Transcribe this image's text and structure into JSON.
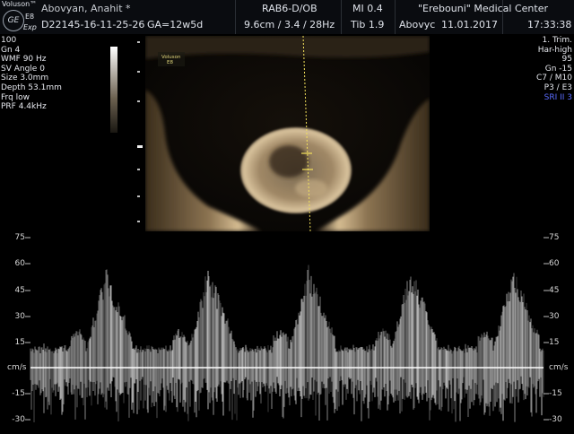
{
  "header": {
    "brand": "Voluson™",
    "model_line1": "E8",
    "model_line2": "Exp",
    "patient_name": "Abovyan, Anahit *",
    "patient_id": "D22145-16-11-25-26",
    "gestational_age": "GA=12w5d",
    "probe": "RAB6-D/OB",
    "depth_freq": "9.6cm / 3.4 / 28Hz",
    "mi": "MI  0.4",
    "tib": "Tib  1.9",
    "operator": "Abovyc",
    "date": "11.01.2017",
    "institution": "\"Erebouni\" Medical Center",
    "time": "17:33:38"
  },
  "left_params": [
    "100  ",
    "Gn  4",
    "WMF 90 Hz",
    "SV Angle  0",
    "Size  3.0mm",
    "Depth 53.1mm",
    "Frq low",
    "PRF  4.4kHz"
  ],
  "right_params": [
    "1. Trim.",
    "Har-high",
    "95",
    "Gn -15",
    "C7 / M10",
    "P3 / E3"
  ],
  "sri_label": "SRI II 3",
  "image_watermark": {
    "line1": "Voluson",
    "line2": "E8"
  },
  "doppler": {
    "unit_label": "cm/s",
    "scale_ticks": [
      "75",
      "60",
      "45",
      "30",
      "15",
      "-15",
      "-30"
    ],
    "colors": {
      "spectrum": "#e8e8e8",
      "baseline": "#ffffff",
      "sri": "#5b6cff"
    }
  }
}
